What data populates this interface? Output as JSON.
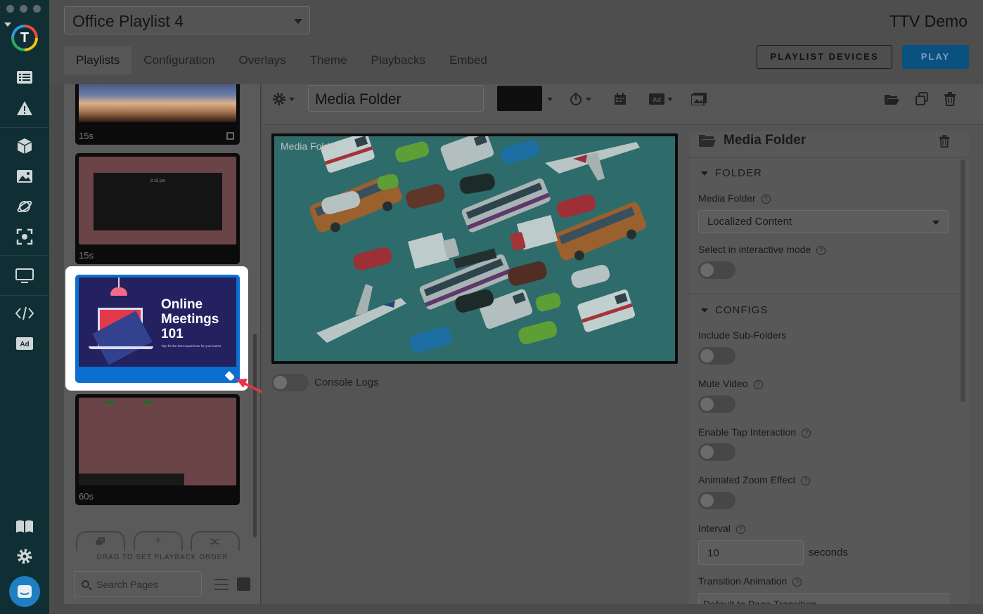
{
  "app": {
    "brand": "TTV Demo",
    "playlist": "Office Playlist 4"
  },
  "tabs": [
    {
      "label": "Playlists",
      "active": true
    },
    {
      "label": "Configuration"
    },
    {
      "label": "Overlays"
    },
    {
      "label": "Theme"
    },
    {
      "label": "Playbacks"
    },
    {
      "label": "Embed"
    }
  ],
  "actions": {
    "devices": "PLAYLIST DEVICES",
    "play": "PLAY"
  },
  "rail": {
    "logo_letter": "T",
    "icons": [
      "list-icon",
      "warning-icon",
      "cube-icon",
      "image-icon",
      "planet-icon",
      "scan-icon",
      "monitor-icon",
      "code-icon",
      "ad-icon",
      "book-icon",
      "gear-icon",
      "chat-avatar-icon"
    ]
  },
  "pages": {
    "items": [
      {
        "duration": "15s",
        "kind": "photo"
      },
      {
        "duration": "15s",
        "kind": "clock",
        "clock_text": "3:15 pm"
      },
      {
        "duration": "",
        "kind": "slide",
        "title": "Online Meetings 101",
        "subtitle": "Tips for the best experience for your teams",
        "selected": true
      },
      {
        "duration": "60s",
        "kind": "dashboard"
      }
    ],
    "drag_hint": "DRAG TO SET PLAYBACK ORDER",
    "search_placeholder": "Search Pages",
    "add_label": "+"
  },
  "editor": {
    "page_name": "Media Folder",
    "preview_label": "Media Folder",
    "console_logs": "Console Logs",
    "ad_label": "Ad"
  },
  "props": {
    "title": "Media Folder",
    "folder_section": "FOLDER",
    "media_folder_label": "Media Folder",
    "media_folder_value": "Localized Content",
    "select_interactive": "Select in interactive mode",
    "configs_section": "CONFIGS",
    "include_sub": "Include Sub-Folders",
    "mute_video": "Mute Video",
    "tap_interaction": "Enable Tap Interaction",
    "zoom_effect": "Animated Zoom Effect",
    "interval_label": "Interval",
    "interval_value": "10",
    "interval_unit": "seconds",
    "transition_label": "Transition Animation",
    "transition_value": "Default to Page Transition"
  },
  "colors": {
    "rail": "#0f2f35",
    "play_button": "#0a517f",
    "selected_card": "#0a6fd0",
    "annotation_arrow": "#e8334a"
  }
}
